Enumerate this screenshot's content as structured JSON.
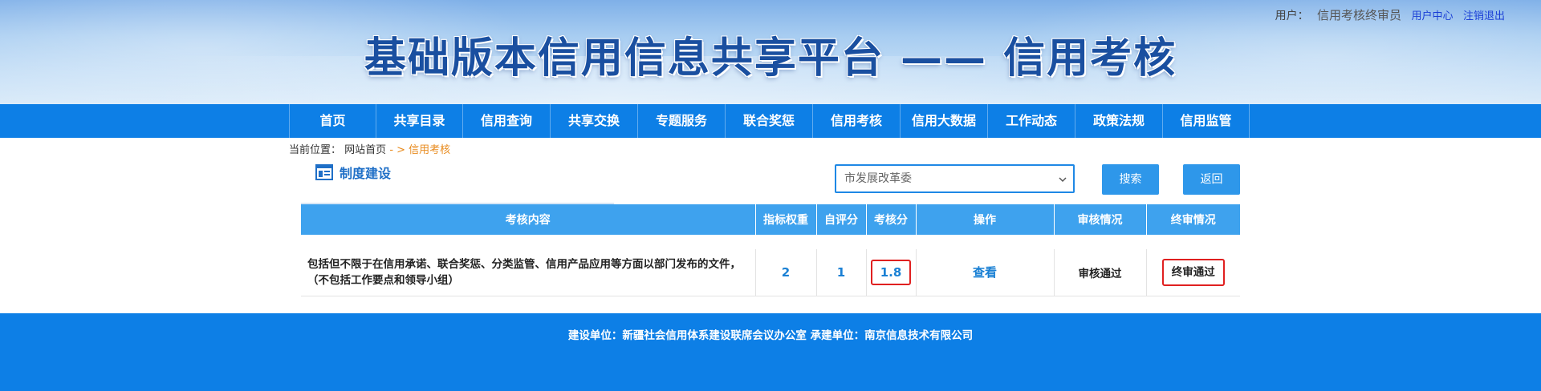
{
  "header": {
    "title": "基础版本信用信息共享平台 —— 信用考核",
    "user_label": "用户：",
    "user_name": "信用考核终审员",
    "user_center": "用户中心",
    "logout": "注销退出"
  },
  "nav": {
    "items": [
      "首页",
      "共享目录",
      "信用查询",
      "共享交换",
      "专题服务",
      "联合奖惩",
      "信用考核",
      "信用大数据",
      "工作动态",
      "政策法规",
      "信用监管"
    ]
  },
  "breadcrumb": {
    "prefix": "当前位置：",
    "home": "网站首页",
    "current": "- > 信用考核"
  },
  "section": {
    "title": "制度建设",
    "icon": "document-icon"
  },
  "filter": {
    "selected": "市发展改革委"
  },
  "buttons": {
    "search": "搜索",
    "back": "返回"
  },
  "table": {
    "headers": [
      "考核内容",
      "指标权重",
      "自评分",
      "考核分",
      "操作",
      "审核情况",
      "终审情况"
    ],
    "rows": [
      {
        "content": "包括但不限于在信用承诺、联合奖惩、分类监管、信用产品应用等方面以部门发布的文件，（不包括工作要点和领导小组）",
        "weight": "2",
        "self_score": "1",
        "review_score": "1.8",
        "action": "查看",
        "audit_status": "审核通过",
        "final_status": "终审通过"
      }
    ]
  },
  "footer": {
    "text": "建设单位：新疆社会信用体系建设联席会议办公室 承建单位：南京信息技术有限公司"
  },
  "colors": {
    "nav_bg": "#0d7fe6",
    "table_header_bg": "#3ea2ee",
    "highlight_border": "#e02020",
    "breadcrumb_current": "#e88a1c"
  }
}
